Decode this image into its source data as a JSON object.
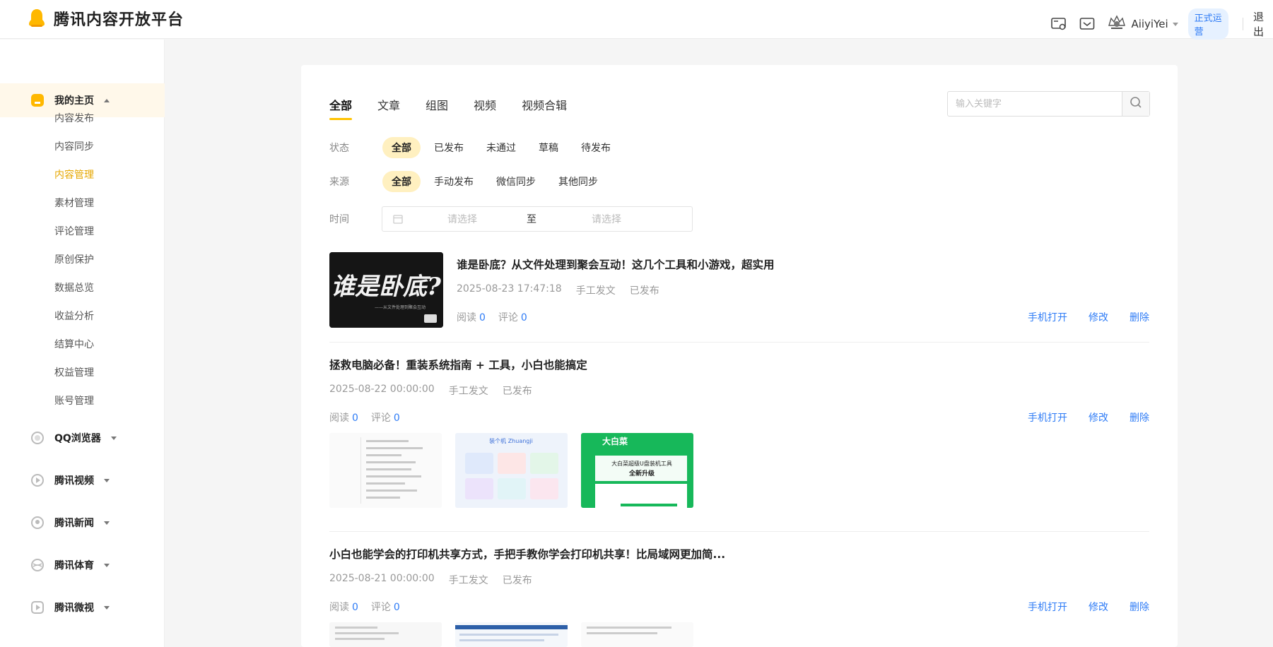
{
  "header": {
    "brand": "腾讯内容开放平台",
    "username": "AiiyiYei",
    "status_badge": "正式运营",
    "logout": "退出",
    "icons": [
      "screen-icon",
      "message-icon",
      "avatar-icon"
    ]
  },
  "sidebar": {
    "home_label": "我的主页",
    "sub_items": [
      "内容发布",
      "内容同步",
      "内容管理",
      "素材管理",
      "评论管理",
      "原创保护",
      "数据总览",
      "收益分析",
      "结算中心",
      "权益管理",
      "账号管理"
    ],
    "active_sub": "内容管理",
    "groups": [
      "QQ浏览器",
      "腾讯视频",
      "腾讯新闻",
      "腾讯体育",
      "腾讯微视"
    ]
  },
  "main": {
    "tabs": [
      "全部",
      "文章",
      "组图",
      "视频",
      "视频合辑"
    ],
    "active_tab": "全部",
    "search_placeholder": "输入关键字",
    "filters": {
      "status_label": "状态",
      "status_options": [
        "全部",
        "已发布",
        "未通过",
        "草稿",
        "待发布"
      ],
      "source_label": "来源",
      "source_options": [
        "全部",
        "手动发布",
        "微信同步",
        "其他同步"
      ],
      "time_label": "时间",
      "date_from_placeholder": "请选择",
      "date_to_label": "至",
      "date_to_placeholder": "请选择"
    },
    "articles": [
      {
        "title": "谁是卧底？从文件处理到聚会互动！这几个工具和小游戏，超实用",
        "time": "2025-08-23 17:47:18",
        "source": "手工发文",
        "status": "已发布",
        "read_label": "阅读",
        "read": "0",
        "comment_label": "评论",
        "comment": "0",
        "thumb_text": "谁是卧底?",
        "thumb_caption": "——从文件处理到聚会互动"
      },
      {
        "title": "拯救电脑必备！重装系统指南 + 工具，小白也能搞定",
        "time": "2025-08-22 00:00:00",
        "source": "手工发文",
        "status": "已发布",
        "read_label": "阅读",
        "read": "0",
        "comment_label": "评论",
        "comment": "0",
        "pic2_title": "装个机 Zhuangji",
        "pic3_brand": "大白菜",
        "pic3_line1": "大白菜超级U盘装机工具",
        "pic3_line2": "全新升级"
      },
      {
        "title": "小白也能学会的打印机共享方式，手把手教你学会打印机共享！比局域网更加简...",
        "time": "2025-08-21 00:00:00",
        "source": "手工发文",
        "status": "已发布",
        "read_label": "阅读",
        "read": "0",
        "comment_label": "评论",
        "comment": "0"
      }
    ],
    "actions": {
      "open_mobile": "手机打开",
      "edit": "修改",
      "delete": "删除"
    }
  },
  "colors": {
    "accent": "#ffc300",
    "link": "#2f7cf6",
    "active_nav_bg": "#fff8ea"
  }
}
